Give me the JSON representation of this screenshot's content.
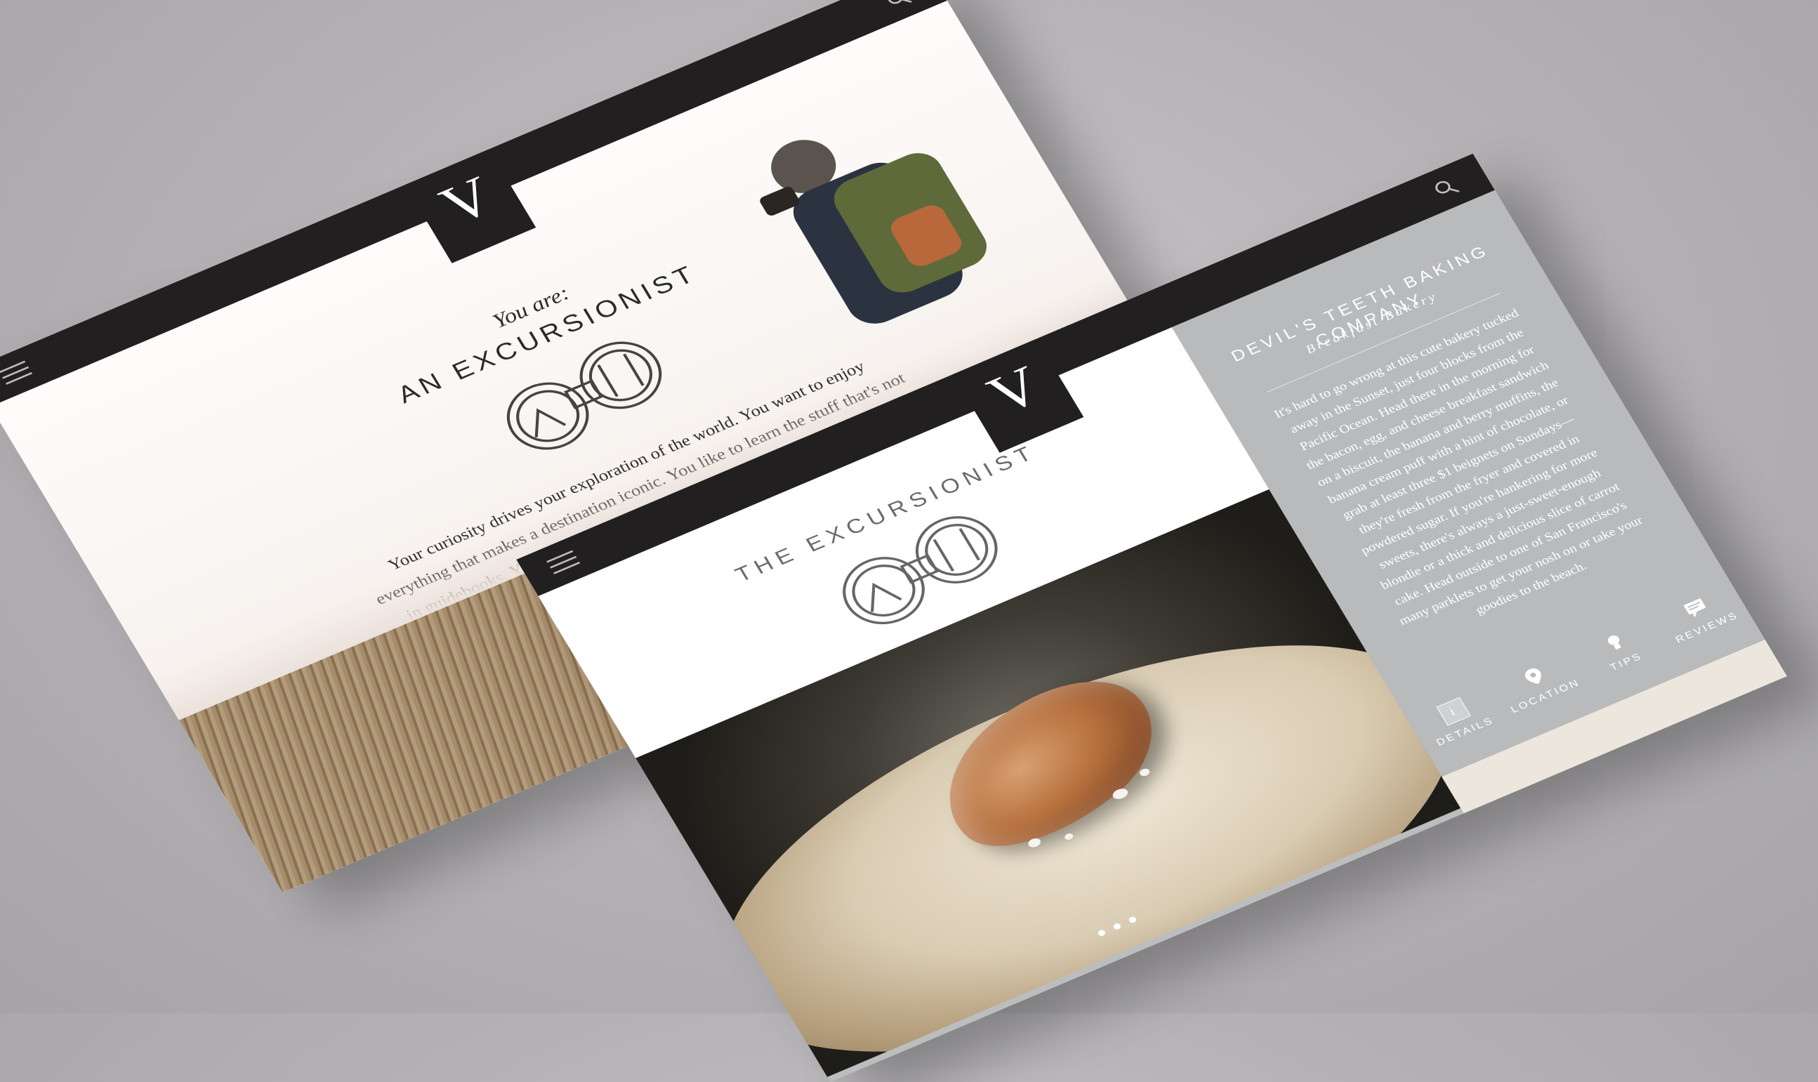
{
  "back_screen": {
    "logo": "V",
    "you_are": "You are:",
    "archetype": "AN EXCURSIONIST",
    "description": "Your curiosity drives your exploration of the world. You want to enjoy everything that makes a destination iconic. You like to learn the stuff that's not in guidebooks. You seek, ... wanderlust. When you're not traveling, you..."
  },
  "front_screen": {
    "logo": "V",
    "title": "THE EXCURSIONIST",
    "business": {
      "name": "DEVIL'S TEETH BAKING COMPANY",
      "type": "Breakfast Bakery",
      "body": "It's hard to go wrong at this cute bakery tucked away in the Sunset, just four blocks from the Pacific Ocean. Head there in the morning for the bacon, egg, and cheese breakfast sandwich on a biscuit, the banana and berry muffins, the banana cream puff with a hint of chocolate, or grab at least three $1 beignets on Sundays—they're fresh from the fryer and covered in powdered sugar. If you're hankering for more sweets, there's always a just-sweet-enough blondie or a thick and delicious slice of carrot cake. Head outside to one of San Francisco's many parklets to get your nosh on or take your goodies to the beach."
    },
    "tabs": [
      {
        "label": "DETAILS",
        "icon": "details-icon",
        "badge": "i"
      },
      {
        "label": "LOCATION",
        "icon": "location-pin-icon"
      },
      {
        "label": "TIPS",
        "icon": "lightbulb-icon"
      },
      {
        "label": "REVIEWS",
        "icon": "speech-bubble-icon"
      }
    ],
    "carousel": {
      "dots": 3
    }
  },
  "colors": {
    "topbar": "#221f20",
    "panel": "#b9babc"
  }
}
